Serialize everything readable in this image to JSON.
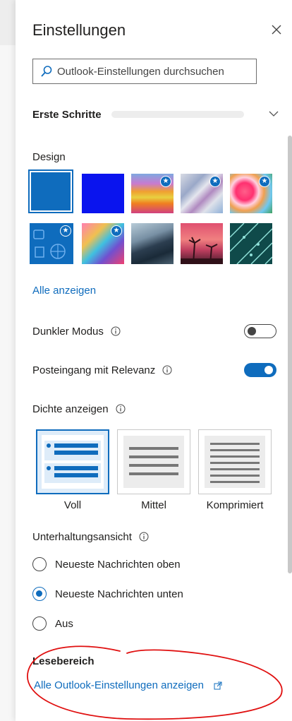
{
  "panel": {
    "title": "Einstellungen",
    "close_icon": "close-icon",
    "search_placeholder": "Outlook-Einstellungen durchsuchen",
    "first_steps_label": "Erste Schritte"
  },
  "design": {
    "label": "Design",
    "themes": [
      {
        "name": "Blau",
        "selected": true,
        "premium": false
      },
      {
        "name": "Dunkelblau",
        "selected": false,
        "premium": false
      },
      {
        "name": "Farbstreifen",
        "selected": false,
        "premium": true
      },
      {
        "name": "Bänder",
        "selected": false,
        "premium": true
      },
      {
        "name": "Illustration",
        "selected": false,
        "premium": true
      },
      {
        "name": "Sport",
        "selected": false,
        "premium": true
      },
      {
        "name": "Spielzeug",
        "selected": false,
        "premium": true
      },
      {
        "name": "Berge",
        "selected": false,
        "premium": false
      },
      {
        "name": "Palmen",
        "selected": false,
        "premium": false
      },
      {
        "name": "Schaltkreis",
        "selected": false,
        "premium": false
      }
    ],
    "show_all": "Alle anzeigen"
  },
  "dark_mode": {
    "label": "Dunkler Modus",
    "enabled": false
  },
  "focused_inbox": {
    "label": "Posteingang mit Relevanz",
    "enabled": true
  },
  "density": {
    "label": "Dichte anzeigen",
    "options": [
      {
        "label": "Voll",
        "selected": true
      },
      {
        "label": "Mittel",
        "selected": false
      },
      {
        "label": "Komprimiert",
        "selected": false
      }
    ]
  },
  "conversation": {
    "label": "Unterhaltungsansicht",
    "options": [
      {
        "label": "Neueste Nachrichten oben",
        "checked": false
      },
      {
        "label": "Neueste Nachrichten unten",
        "checked": true
      },
      {
        "label": "Aus",
        "checked": false
      }
    ]
  },
  "reading_pane": {
    "label": "Lesebereich"
  },
  "footer": {
    "all_settings": "Alle Outlook-Einstellungen anzeigen"
  },
  "colors": {
    "accent": "#0f6cbd",
    "annotation": "#e01010"
  }
}
